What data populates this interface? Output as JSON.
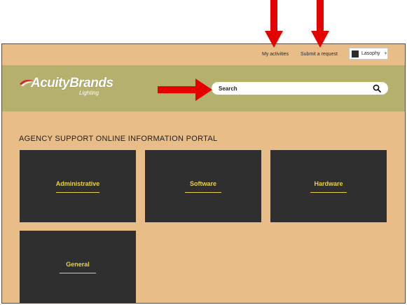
{
  "topnav": {
    "my_activities": "My activities",
    "submit_request": "Submit a request",
    "user_name": "Lasophy"
  },
  "header": {
    "logo_brand": "AcuityBrands",
    "logo_sub": "Lighting",
    "search_label": "Search"
  },
  "main": {
    "title": "AGENCY SUPPORT ONLINE INFORMATION PORTAL",
    "categories": [
      {
        "label": "Administrative"
      },
      {
        "label": "Software"
      },
      {
        "label": "Hardware"
      },
      {
        "label": "General"
      }
    ]
  },
  "colors": {
    "page_bg": "#e8bd88",
    "header_bg": "#b5b06b",
    "tile_bg": "#2f2f2f",
    "tile_text": "#e8d14a",
    "annotation_arrow": "#e60000"
  },
  "icons": [
    "search-icon",
    "chevron-down-icon",
    "avatar",
    "logo-swoosh-icon"
  ]
}
